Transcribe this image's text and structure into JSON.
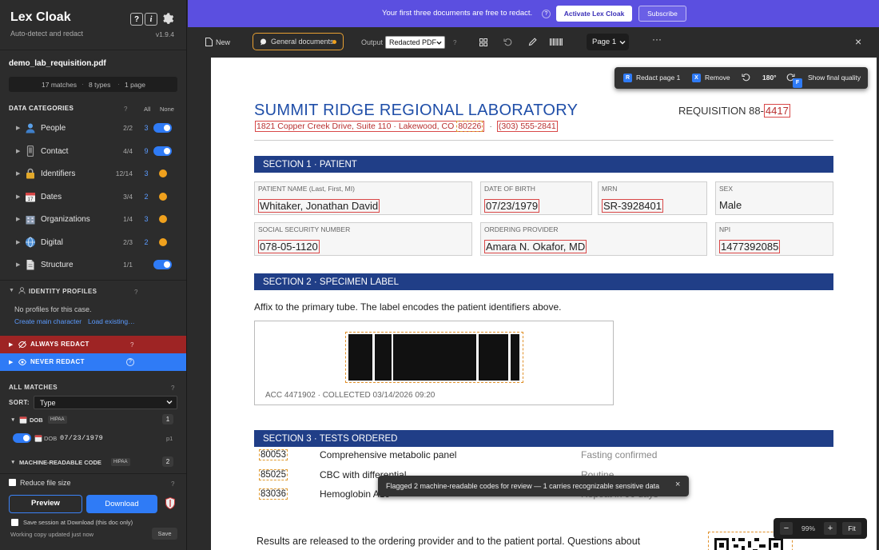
{
  "app": {
    "name": "Lex Cloak",
    "tagline": "Auto-detect and redact",
    "version": "v1.9.4",
    "help_label": "?",
    "info_label": "i"
  },
  "file": {
    "name": "demo_lab_requisition.pdf"
  },
  "summary": {
    "matches": "17 matches",
    "types": "8 types",
    "pages": "1 page"
  },
  "categories": {
    "header": "DATA CATEGORIES",
    "help": "?",
    "all": "All",
    "none": "None",
    "items": [
      {
        "label": "People",
        "fraction": "2/2",
        "count": "3",
        "state": "on"
      },
      {
        "label": "Contact",
        "fraction": "4/4",
        "count": "9",
        "state": "on"
      },
      {
        "label": "Identifiers",
        "fraction": "12/14",
        "count": "3",
        "state": "partial"
      },
      {
        "label": "Dates",
        "fraction": "3/4",
        "count": "2",
        "state": "partial"
      },
      {
        "label": "Organizations",
        "fraction": "1/4",
        "count": "3",
        "state": "partial"
      },
      {
        "label": "Digital",
        "fraction": "2/3",
        "count": "2",
        "state": "partial"
      },
      {
        "label": "Structure",
        "fraction": "1/1",
        "count": "",
        "state": "on"
      }
    ]
  },
  "identity": {
    "header": "IDENTITY PROFILES",
    "help": "?",
    "empty": "No profiles for this case.",
    "create": "Create main character",
    "load": "Load existing…"
  },
  "always_redact": {
    "label": "ALWAYS REDACT",
    "help": "?"
  },
  "never_redact": {
    "label": "NEVER REDACT",
    "help": "?"
  },
  "all_matches": {
    "header": "ALL MATCHES",
    "help": "?",
    "sort_label": "SORT:",
    "sort_value": "Type"
  },
  "groups": [
    {
      "label": "DOB",
      "tag": "HIPAA",
      "count": "1",
      "entry_label": "DOB",
      "entry_value": "07/23/1979",
      "entry_page": "p1"
    },
    {
      "label": "MACHINE-READABLE CODE",
      "tag": "HIPAA",
      "count": "2"
    }
  ],
  "footer": {
    "reduce": "Reduce file size",
    "reduce_help": "?",
    "preview": "Preview",
    "download": "Download",
    "save_session": "Save session at Download (this doc only)",
    "status": "Working copy updated just now",
    "save": "Save"
  },
  "banner": {
    "text": "Your first three documents are free to redact.",
    "help": "?",
    "activate": "Activate Lex Cloak",
    "subscribe": "Subscribe"
  },
  "toolbar": {
    "new": "New",
    "mode": "General documents",
    "output_label": "Output",
    "output_value": "Redacted PDF",
    "help": "?",
    "page": "Page 1"
  },
  "popup": {
    "redact_key": "R",
    "redact": "Redact page 1",
    "remove_key": "X",
    "remove": "Remove",
    "rotate": "180°",
    "final_key": "F",
    "final": "Show final quality"
  },
  "doc": {
    "title": "SUMMIT RIDGE REGIONAL LABORATORY",
    "req_prefix": "REQUISITION 88-",
    "req_num": "4417",
    "address_a": "1821 Copper Creek Drive, Suite 110  ·  Lakewood, CO ",
    "address_zip": "80226",
    "sep": "·",
    "phone": "(303) 555-2841",
    "s1": "SECTION 1 · PATIENT",
    "f_name_l": "PATIENT NAME (Last, First, MI)",
    "f_name_v": "Whitaker, Jonathan David",
    "f_dob_l": "DATE OF BIRTH",
    "f_dob_v": "07/23/1979",
    "f_mrn_l": "MRN",
    "f_mrn_v": "SR-3928401",
    "f_sex_l": "SEX",
    "f_sex_v": "Male",
    "f_ssn_l": "SOCIAL SECURITY NUMBER",
    "f_ssn_v": "078-05-1120",
    "f_prov_l": "ORDERING PROVIDER",
    "f_prov_v": "Amara N. Okafor, MD",
    "f_npi_l": "NPI",
    "f_npi_v": "1477392085",
    "s2": "SECTION 2 · SPECIMEN LABEL",
    "s2_text": "Affix to the primary tube. The label encodes the patient identifiers above.",
    "label_caption": "ACC 4471902  ·  COLLECTED 03/14/2026 09:20",
    "s3": "SECTION 3 · TESTS ORDERED",
    "tests": [
      {
        "code": "80053",
        "name": "Comprehensive metabolic panel",
        "note": "Fasting confirmed"
      },
      {
        "code": "85025",
        "name": "CBC with differential",
        "note": "Routine"
      },
      {
        "code": "83036",
        "name": "Hemoglobin A1c",
        "note": "Repeat in 90 days"
      }
    ],
    "results_text": "Results are released to the ordering provider and to the patient portal. Questions about"
  },
  "toast": {
    "text": "Flagged 2 machine-readable codes for review — 1 carries recognizable sensitive data",
    "close": "×"
  },
  "zoom": {
    "minus": "−",
    "value": "99%",
    "plus": "+",
    "fit": "Fit"
  }
}
